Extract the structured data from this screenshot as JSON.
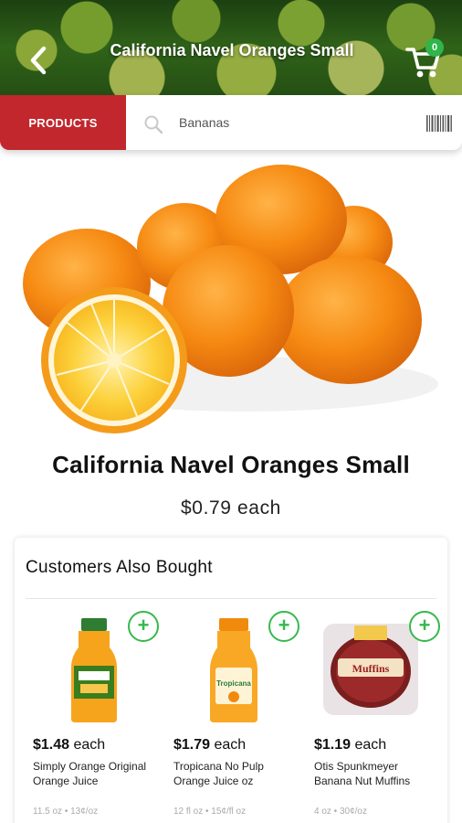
{
  "header": {
    "title": "California Navel Oranges Small",
    "cart_count": "0"
  },
  "search": {
    "products_label": "PRODUCTS",
    "value": "Bananas"
  },
  "product": {
    "name": "California Navel Oranges Small",
    "price": "$0.79 each"
  },
  "also_bought": {
    "title": "Customers Also Bought",
    "items": [
      {
        "price": "$1.48",
        "unit": " each",
        "name": "Simply Orange Original Orange Juice",
        "size": "11.5 oz • 13¢/oz"
      },
      {
        "price": "$1.79",
        "unit": " each",
        "name": "Tropicana No Pulp Orange Juice oz",
        "size": "12 fl oz • 15¢/fl oz"
      },
      {
        "price": "$1.19",
        "unit": " each",
        "name": "Otis Spunkmeyer Banana Nut Muffins",
        "size": "4 oz • 30¢/oz"
      }
    ],
    "add_symbol": "+"
  },
  "colors": {
    "brand_red": "#c1272d",
    "accent_green": "#35b94c"
  },
  "icons": [
    "back-chevron-icon",
    "cart-icon",
    "search-icon",
    "barcode-icon",
    "plus-icon"
  ]
}
